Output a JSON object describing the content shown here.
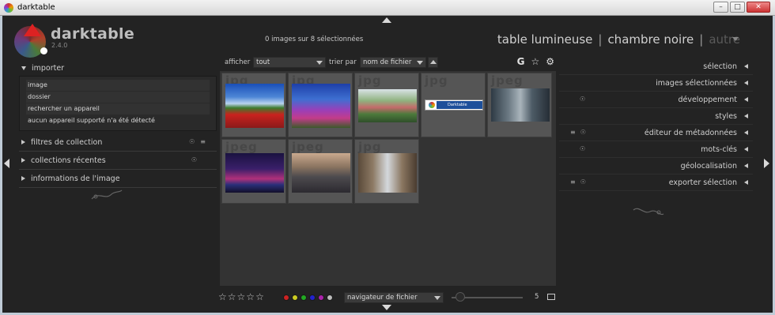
{
  "window": {
    "title": "darktable",
    "controls": [
      "minimize",
      "maximize",
      "close"
    ]
  },
  "header": {
    "app_name": "darktable",
    "version": "2.4.0",
    "selection_status": "0 images sur 8 sélectionnées",
    "views": [
      {
        "label": "table lumineuse",
        "active": true
      },
      {
        "label": "chambre noire",
        "active": false
      },
      {
        "label": "autre",
        "active": false
      }
    ],
    "separator": "|"
  },
  "left_panel": {
    "import_module": {
      "title": "importer",
      "items": [
        "image",
        "dossier",
        "rechercher un appareil",
        "aucun appareil supporté n'a été détecté"
      ]
    },
    "modules": [
      {
        "title": "filtres de collection",
        "icons": [
          "reset-icon",
          "presets-icon"
        ]
      },
      {
        "title": "collections récentes",
        "icons": [
          "reset-icon"
        ]
      },
      {
        "title": "informations de l'image",
        "icons": []
      }
    ]
  },
  "toolbar": {
    "show_label": "afficher",
    "show_value": "tout",
    "sort_label": "trier par",
    "sort_value": "nom de fichier",
    "icons": [
      "grouping-icon",
      "star-icon",
      "settings-icon"
    ],
    "grouping_glyph": "G",
    "star_glyph": "☆",
    "gear_glyph": "⚙"
  },
  "thumbnails": [
    {
      "ext": "jpg",
      "kind": "poppies"
    },
    {
      "ext": "jpg",
      "kind": "flowers"
    },
    {
      "ext": "jpg",
      "kind": "garden"
    },
    {
      "ext": "jpg",
      "kind": "banner",
      "banner_text": "Darktable"
    },
    {
      "ext": "jpeg",
      "kind": "street"
    },
    {
      "ext": "jpeg",
      "kind": "city-night"
    },
    {
      "ext": "jpeg",
      "kind": "skyline"
    },
    {
      "ext": "jpg",
      "kind": "buildings"
    }
  ],
  "bottom_bar": {
    "star_rating": 0,
    "star_count": 5,
    "star_glyph": "☆",
    "color_labels": [
      "#cc2222",
      "#cccc22",
      "#22aa22",
      "#2222cc",
      "#aa22aa",
      "#bbbbbb"
    ],
    "browser_select": "navigateur de fichier",
    "zoom_value": "5"
  },
  "right_panel": {
    "modules": [
      {
        "title": "sélection",
        "icons": []
      },
      {
        "title": "images sélectionnées",
        "icons": []
      },
      {
        "title": "développement",
        "icons": [
          "reset-icon"
        ]
      },
      {
        "title": "styles",
        "icons": []
      },
      {
        "title": "éditeur de métadonnées",
        "icons": [
          "presets-icon",
          "reset-icon"
        ]
      },
      {
        "title": "mots-clés",
        "icons": [
          "reset-icon"
        ]
      },
      {
        "title": "géolocalisation",
        "icons": []
      },
      {
        "title": "exporter sélection",
        "icons": [
          "presets-icon",
          "reset-icon"
        ]
      }
    ]
  },
  "colors": {
    "background": "#232323",
    "panel": "#2a2a2a",
    "lighttable": "#333333",
    "text": "#c8c8c8"
  }
}
